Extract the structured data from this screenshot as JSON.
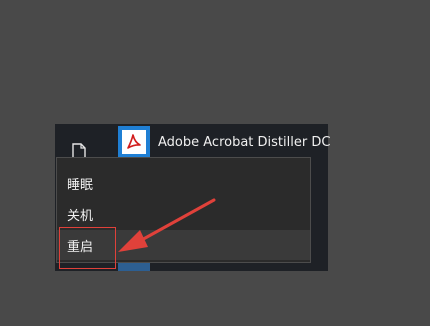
{
  "start_menu": {
    "app_title": "Adobe Acrobat Distiller DC",
    "app_icon": "adobe-acrobat-icon",
    "doc_icon": "document-icon"
  },
  "power_menu": {
    "items": [
      {
        "label": "睡眠"
      },
      {
        "label": "关机"
      },
      {
        "label": "重启"
      }
    ]
  },
  "annotation": {
    "color": "#e0413a"
  }
}
